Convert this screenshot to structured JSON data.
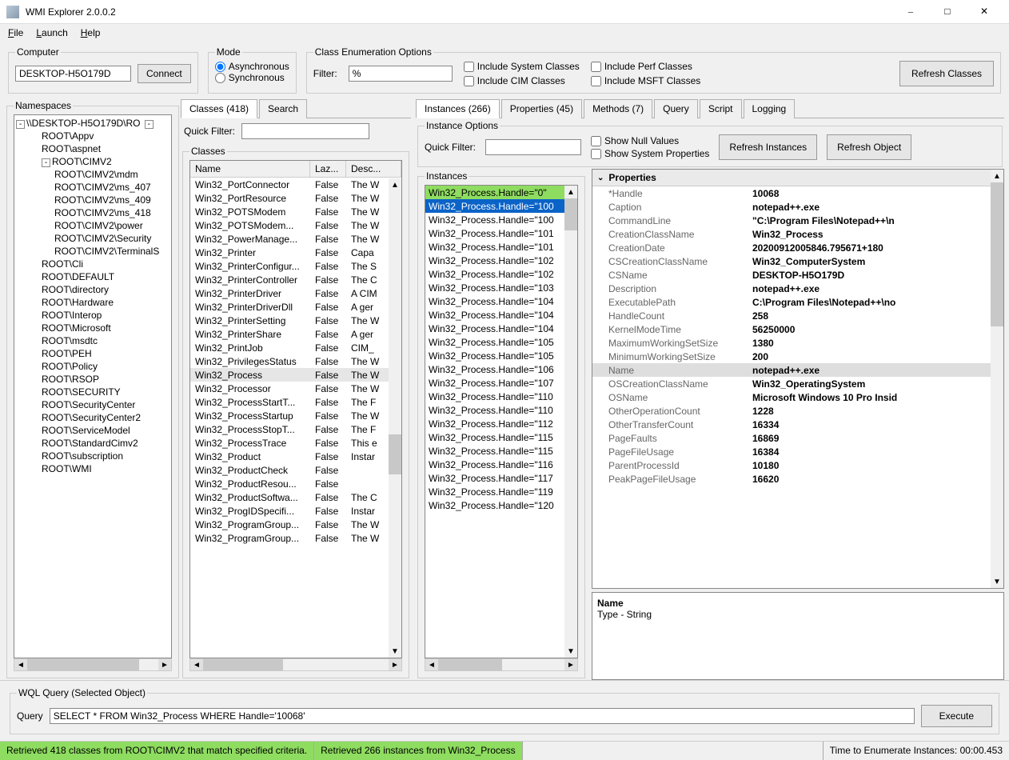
{
  "window": {
    "title": "WMI Explorer 2.0.0.2"
  },
  "menubar": {
    "file": "File",
    "launch": "Launch",
    "help": "Help"
  },
  "computer": {
    "legend": "Computer",
    "value": "DESKTOP-H5O179D",
    "connect": "Connect"
  },
  "mode": {
    "legend": "Mode",
    "async": "Asynchronous",
    "sync": "Synchronous",
    "selected": "async"
  },
  "enum": {
    "legend": "Class Enumeration Options",
    "filter_label": "Filter:",
    "filter_value": "%",
    "inc_system": "Include System Classes",
    "inc_cim": "Include CIM Classes",
    "inc_perf": "Include Perf Classes",
    "inc_msft": "Include MSFT Classes",
    "refresh": "Refresh Classes"
  },
  "namespaces": {
    "legend": "Namespaces",
    "root": "\\\\DESKTOP-H5O179D\\RO",
    "items": [
      {
        "t": "ROOT\\Appv",
        "lvl": 2
      },
      {
        "t": "ROOT\\aspnet",
        "lvl": 2
      },
      {
        "t": "ROOT\\CIMV2",
        "lvl": 2,
        "exp": true
      },
      {
        "t": "ROOT\\CIMV2\\mdm",
        "lvl": 3
      },
      {
        "t": "ROOT\\CIMV2\\ms_407",
        "lvl": 3
      },
      {
        "t": "ROOT\\CIMV2\\ms_409",
        "lvl": 3
      },
      {
        "t": "ROOT\\CIMV2\\ms_418",
        "lvl": 3
      },
      {
        "t": "ROOT\\CIMV2\\power",
        "lvl": 3
      },
      {
        "t": "ROOT\\CIMV2\\Security",
        "lvl": 3
      },
      {
        "t": "ROOT\\CIMV2\\TerminalS",
        "lvl": 3
      },
      {
        "t": "ROOT\\Cli",
        "lvl": 2
      },
      {
        "t": "ROOT\\DEFAULT",
        "lvl": 2
      },
      {
        "t": "ROOT\\directory",
        "lvl": 2
      },
      {
        "t": "ROOT\\Hardware",
        "lvl": 2
      },
      {
        "t": "ROOT\\Interop",
        "lvl": 2
      },
      {
        "t": "ROOT\\Microsoft",
        "lvl": 2
      },
      {
        "t": "ROOT\\msdtc",
        "lvl": 2
      },
      {
        "t": "ROOT\\PEH",
        "lvl": 2
      },
      {
        "t": "ROOT\\Policy",
        "lvl": 2
      },
      {
        "t": "ROOT\\RSOP",
        "lvl": 2
      },
      {
        "t": "ROOT\\SECURITY",
        "lvl": 2
      },
      {
        "t": "ROOT\\SecurityCenter",
        "lvl": 2
      },
      {
        "t": "ROOT\\SecurityCenter2",
        "lvl": 2
      },
      {
        "t": "ROOT\\ServiceModel",
        "lvl": 2
      },
      {
        "t": "ROOT\\StandardCimv2",
        "lvl": 2
      },
      {
        "t": "ROOT\\subscription",
        "lvl": 2
      },
      {
        "t": "ROOT\\WMI",
        "lvl": 2
      }
    ]
  },
  "classes": {
    "tab_classes": "Classes (418)",
    "tab_search": "Search",
    "quick_filter_label": "Quick Filter:",
    "quick_filter_value": "",
    "legend": "Classes",
    "cols": {
      "name": "Name",
      "lazy": "Laz...",
      "desc": "Desc..."
    },
    "selected": "Win32_Process",
    "rows": [
      {
        "n": "Win32_PortConnector",
        "l": "False",
        "d": "The W"
      },
      {
        "n": "Win32_PortResource",
        "l": "False",
        "d": "The W"
      },
      {
        "n": "Win32_POTSModem",
        "l": "False",
        "d": "The W"
      },
      {
        "n": "Win32_POTSModem...",
        "l": "False",
        "d": "The W"
      },
      {
        "n": "Win32_PowerManage...",
        "l": "False",
        "d": "The W"
      },
      {
        "n": "Win32_Printer",
        "l": "False",
        "d": "Capa"
      },
      {
        "n": "Win32_PrinterConfigur...",
        "l": "False",
        "d": "The S"
      },
      {
        "n": "Win32_PrinterController",
        "l": "False",
        "d": "The C"
      },
      {
        "n": "Win32_PrinterDriver",
        "l": "False",
        "d": "A CIM"
      },
      {
        "n": "Win32_PrinterDriverDll",
        "l": "False",
        "d": "A ger"
      },
      {
        "n": "Win32_PrinterSetting",
        "l": "False",
        "d": "The W"
      },
      {
        "n": "Win32_PrinterShare",
        "l": "False",
        "d": "A ger"
      },
      {
        "n": "Win32_PrintJob",
        "l": "False",
        "d": "CIM_"
      },
      {
        "n": "Win32_PrivilegesStatus",
        "l": "False",
        "d": "The W"
      },
      {
        "n": "Win32_Process",
        "l": "False",
        "d": "The W"
      },
      {
        "n": "Win32_Processor",
        "l": "False",
        "d": "The W"
      },
      {
        "n": "Win32_ProcessStartT...",
        "l": "False",
        "d": "The F"
      },
      {
        "n": "Win32_ProcessStartup",
        "l": "False",
        "d": "The W"
      },
      {
        "n": "Win32_ProcessStopT...",
        "l": "False",
        "d": "The F"
      },
      {
        "n": "Win32_ProcessTrace",
        "l": "False",
        "d": "This e"
      },
      {
        "n": "Win32_Product",
        "l": "False",
        "d": "Instar"
      },
      {
        "n": "Win32_ProductCheck",
        "l": "False",
        "d": ""
      },
      {
        "n": "Win32_ProductResou...",
        "l": "False",
        "d": ""
      },
      {
        "n": "Win32_ProductSoftwa...",
        "l": "False",
        "d": "The C"
      },
      {
        "n": "Win32_ProgIDSpecifi...",
        "l": "False",
        "d": "Instar"
      },
      {
        "n": "Win32_ProgramGroup...",
        "l": "False",
        "d": "The W"
      },
      {
        "n": "Win32_ProgramGroup...",
        "l": "False",
        "d": "The W"
      }
    ]
  },
  "instances": {
    "tabs": {
      "instances": "Instances (266)",
      "properties": "Properties (45)",
      "methods": "Methods (7)",
      "query": "Query",
      "script": "Script",
      "logging": "Logging"
    },
    "opts": {
      "legend": "Instance Options",
      "quick_filter_label": "Quick Filter:",
      "quick_filter_value": "",
      "show_null": "Show Null Values",
      "show_system": "Show System Properties",
      "refresh_instances": "Refresh Instances",
      "refresh_object": "Refresh Object"
    },
    "list_legend": "Instances",
    "rows": [
      "Win32_Process.Handle=\"0\"",
      "Win32_Process.Handle=\"100",
      "Win32_Process.Handle=\"100",
      "Win32_Process.Handle=\"101",
      "Win32_Process.Handle=\"101",
      "Win32_Process.Handle=\"102",
      "Win32_Process.Handle=\"102",
      "Win32_Process.Handle=\"103",
      "Win32_Process.Handle=\"104",
      "Win32_Process.Handle=\"104",
      "Win32_Process.Handle=\"104",
      "Win32_Process.Handle=\"105",
      "Win32_Process.Handle=\"105",
      "Win32_Process.Handle=\"106",
      "Win32_Process.Handle=\"107",
      "Win32_Process.Handle=\"110",
      "Win32_Process.Handle=\"110",
      "Win32_Process.Handle=\"112",
      "Win32_Process.Handle=\"115",
      "Win32_Process.Handle=\"115",
      "Win32_Process.Handle=\"116",
      "Win32_Process.Handle=\"117",
      "Win32_Process.Handle=\"119",
      "Win32_Process.Handle=\"120"
    ]
  },
  "properties": {
    "header": "Properties",
    "rows": [
      {
        "k": "*Handle",
        "v": "10068"
      },
      {
        "k": "Caption",
        "v": "notepad++.exe"
      },
      {
        "k": "CommandLine",
        "v": "\"C:\\Program Files\\Notepad++\\n"
      },
      {
        "k": "CreationClassName",
        "v": "Win32_Process"
      },
      {
        "k": "CreationDate",
        "v": "20200912005846.795671+180"
      },
      {
        "k": "CSCreationClassName",
        "v": "Win32_ComputerSystem"
      },
      {
        "k": "CSName",
        "v": "DESKTOP-H5O179D"
      },
      {
        "k": "Description",
        "v": "notepad++.exe"
      },
      {
        "k": "ExecutablePath",
        "v": "C:\\Program Files\\Notepad++\\no"
      },
      {
        "k": "HandleCount",
        "v": "258"
      },
      {
        "k": "KernelModeTime",
        "v": "56250000"
      },
      {
        "k": "MaximumWorkingSetSize",
        "v": "1380"
      },
      {
        "k": "MinimumWorkingSetSize",
        "v": "200"
      },
      {
        "k": "Name",
        "v": "notepad++.exe",
        "sel": true
      },
      {
        "k": "OSCreationClassName",
        "v": "Win32_OperatingSystem"
      },
      {
        "k": "OSName",
        "v": "Microsoft Windows 10 Pro Insid"
      },
      {
        "k": "OtherOperationCount",
        "v": "1228"
      },
      {
        "k": "OtherTransferCount",
        "v": "16334"
      },
      {
        "k": "PageFaults",
        "v": "16869"
      },
      {
        "k": "PageFileUsage",
        "v": "16384"
      },
      {
        "k": "ParentProcessId",
        "v": "10180"
      },
      {
        "k": "PeakPageFileUsage",
        "v": "16620"
      }
    ],
    "desc_name": "Name",
    "desc_type": "Type - String"
  },
  "query": {
    "legend": "WQL Query (Selected Object)",
    "label": "Query",
    "value": "SELECT * FROM Win32_Process WHERE Handle='10068'",
    "execute": "Execute"
  },
  "status": {
    "left": "Retrieved 418 classes from ROOT\\CIMV2 that match specified criteria.",
    "mid": "Retrieved 266 instances from Win32_Process",
    "right": "Time to Enumerate Instances: 00:00.453"
  }
}
